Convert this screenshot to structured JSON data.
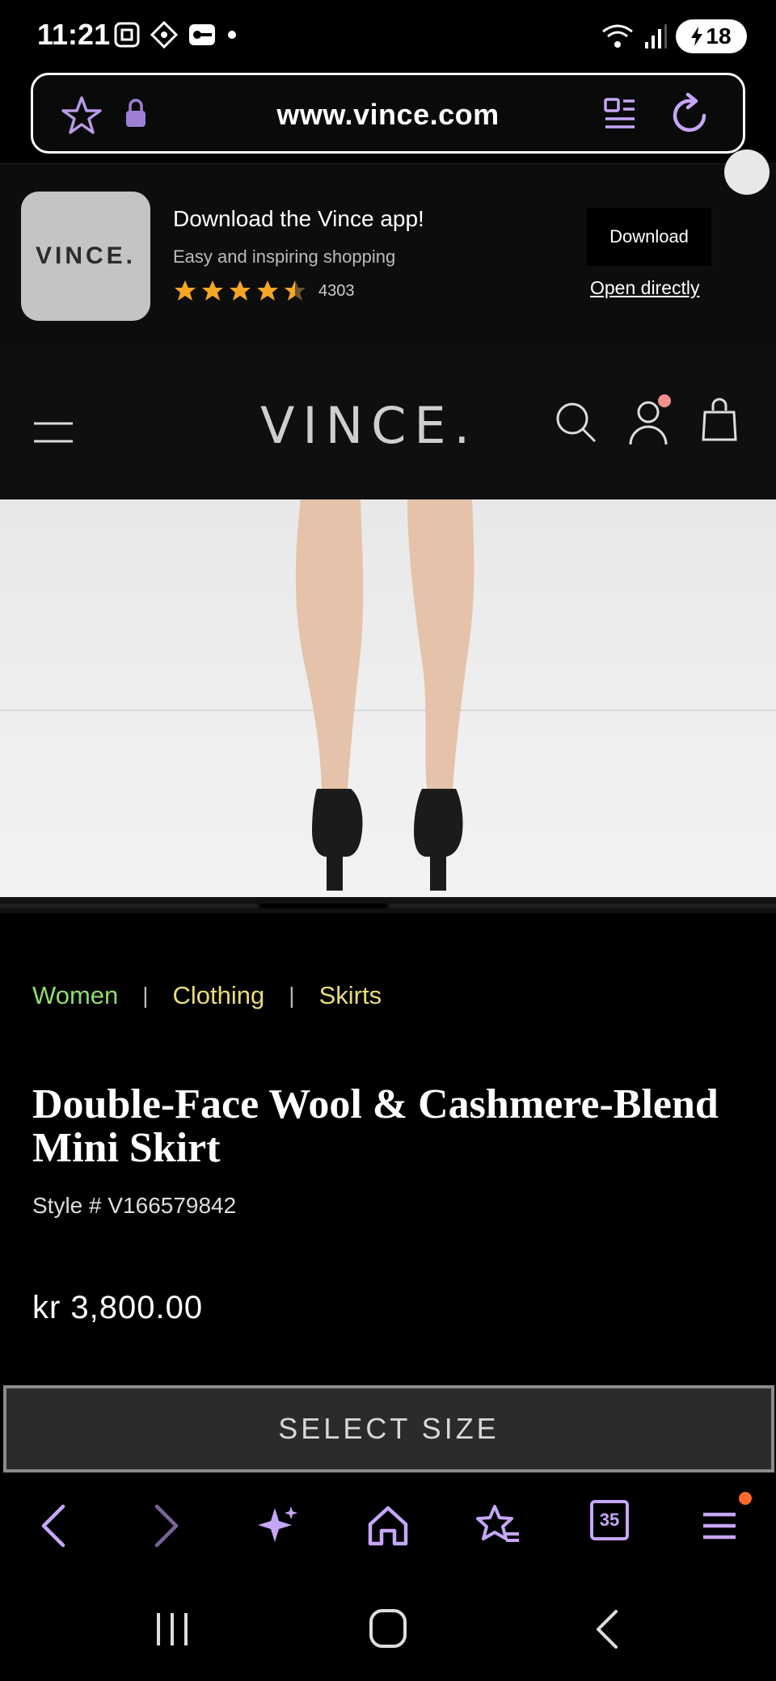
{
  "status_bar": {
    "time": "11:21",
    "battery": "18",
    "network": "6E"
  },
  "browser": {
    "url": "www.vince.com",
    "tabs_count": "35"
  },
  "app_banner": {
    "title": "Download the Vince app!",
    "subtitle": "Easy and inspiring shopping",
    "rating": 4.5,
    "rating_count": "4303",
    "download_label": "Download",
    "open_label": "Open directly",
    "icon_text": "VINCE."
  },
  "site": {
    "logo": "VINCE."
  },
  "breadcrumb": {
    "items": [
      "Women",
      "Clothing",
      "Skirts"
    ],
    "separator": "|"
  },
  "product": {
    "title": "Double-Face Wool & Cashmere-Blend Mini Skirt",
    "style": "Style # V166579842",
    "price": "kr 3,800.00",
    "select_size_label": "SELECT SIZE"
  },
  "colors": {
    "accent": "#c6a6f7",
    "breadcrumb_women": "#8fdc6f",
    "breadcrumb_other": "#e9dc7a",
    "star": "#f5a623"
  }
}
